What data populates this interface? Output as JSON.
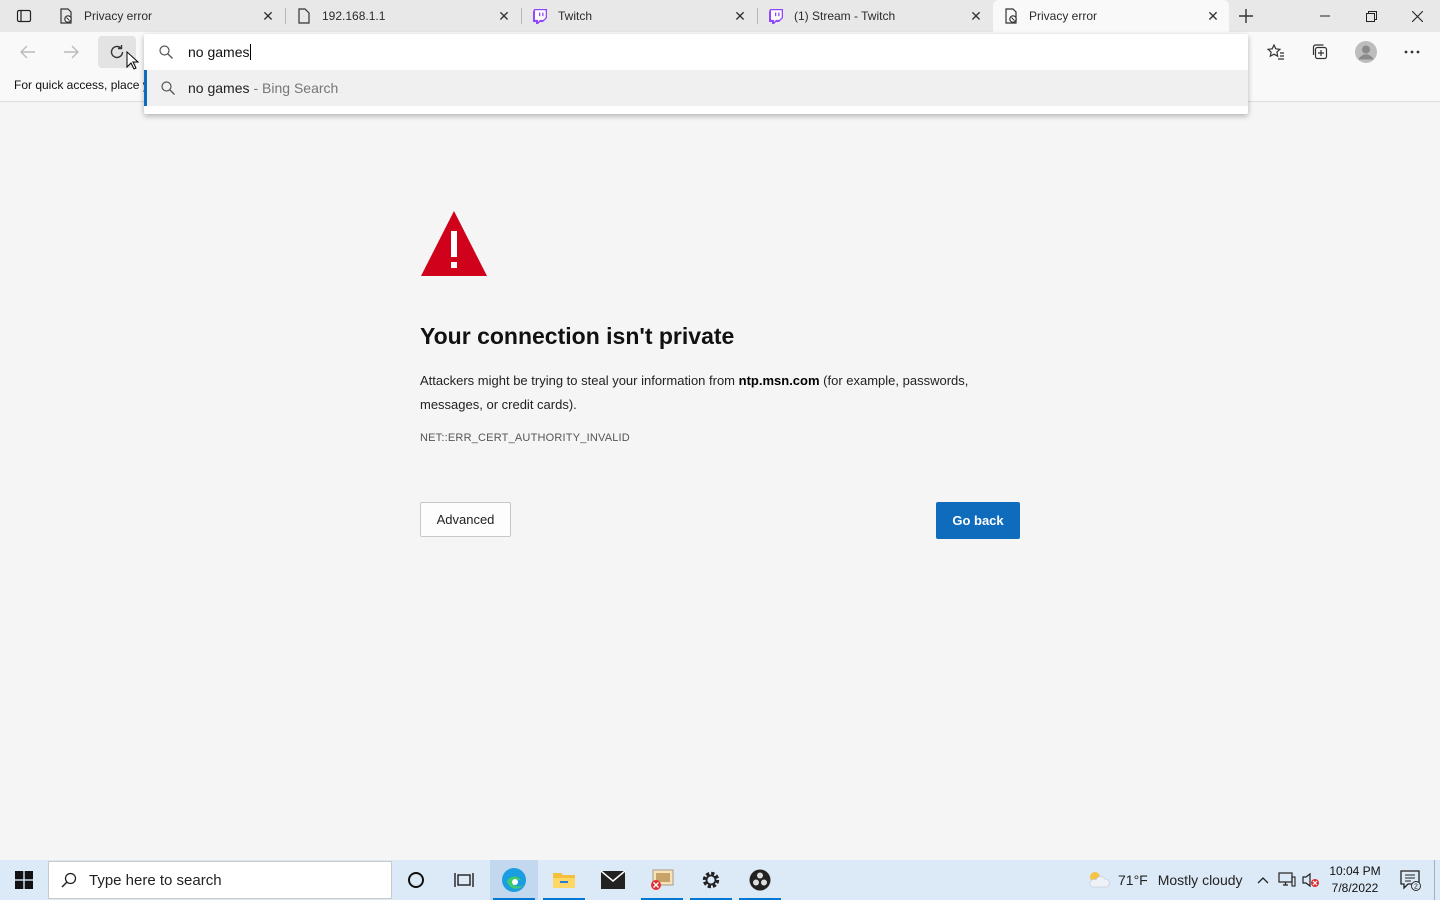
{
  "tabs": [
    {
      "title": "Privacy error",
      "icon": "error-page-icon"
    },
    {
      "title": "192.168.1.1",
      "icon": "page-icon"
    },
    {
      "title": "Twitch",
      "icon": "twitch-icon"
    },
    {
      "title": "(1) Stream - Twitch",
      "icon": "twitch-icon"
    },
    {
      "title": "Privacy error",
      "icon": "error-page-icon",
      "active": true
    }
  ],
  "favbar": {
    "text": "For quick access, place y"
  },
  "omnibox": {
    "value": "no games",
    "suggestion_query": "no games",
    "suggestion_source": "- Bing Search"
  },
  "error": {
    "title": "Your connection isn't private",
    "body_before": "Attackers might be trying to steal your information from ",
    "host": "ntp.msn.com",
    "body_after": " (for example, passwords, messages, or credit cards).",
    "code": "NET::ERR_CERT_AUTHORITY_INVALID",
    "advanced_label": "Advanced",
    "goback_label": "Go back"
  },
  "taskbar": {
    "search_placeholder": "Type here to search",
    "weather_temp": "71°F",
    "weather_desc": "Mostly cloudy",
    "time": "10:04 PM",
    "date": "7/8/2022",
    "notification_count": "2"
  },
  "colors": {
    "accent": "#0f6cbd",
    "warning_red": "#d0021b",
    "twitch_purple": "#9146ff",
    "taskbar": "#dce9f7"
  }
}
